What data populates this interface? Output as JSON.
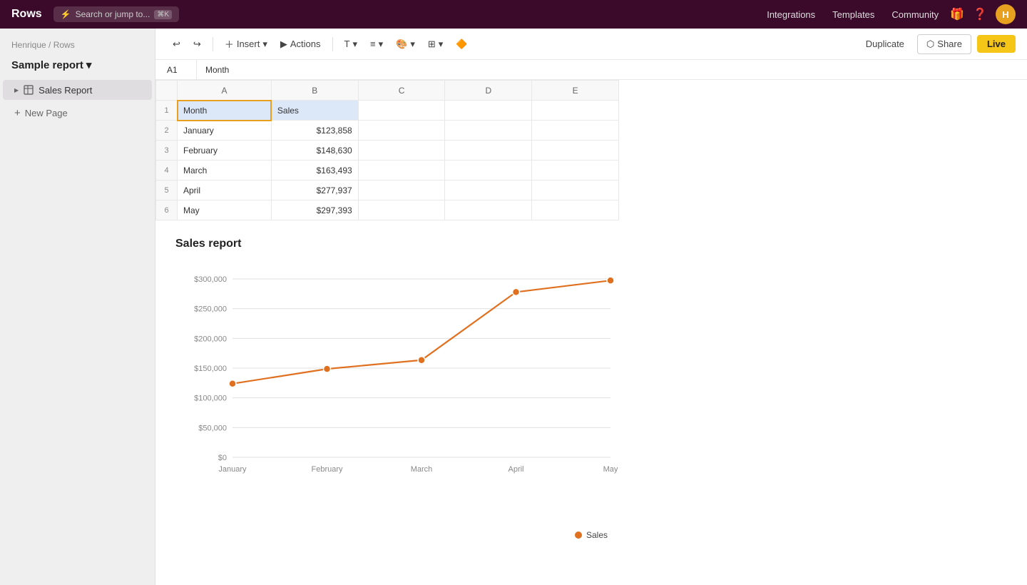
{
  "app": {
    "name": "Rows"
  },
  "topnav": {
    "logo": "Rows",
    "search_placeholder": "Search or jump to...",
    "search_shortcut": "⌘K",
    "links": [
      {
        "label": "Integrations",
        "id": "integrations"
      },
      {
        "label": "Templates",
        "id": "templates"
      },
      {
        "label": "Community",
        "id": "community"
      }
    ],
    "avatar_initial": "H"
  },
  "toolbar": {
    "insert_label": "Insert",
    "actions_label": "Actions",
    "duplicate_label": "Duplicate",
    "share_label": "Share",
    "live_label": "Live"
  },
  "cell_ref": {
    "ref": "A1",
    "value": "Month"
  },
  "sidebar": {
    "breadcrumb": "Henrique / Rows",
    "report_title": "Sample report",
    "report_caret": "▾",
    "pages": [
      {
        "label": "Sales Report",
        "active": true
      }
    ],
    "new_page_label": "New Page"
  },
  "spreadsheet": {
    "col_headers": [
      "A",
      "B",
      "C",
      "D",
      "E"
    ],
    "rows": [
      {
        "num": 1,
        "a": "Month",
        "b": "Sales",
        "c": "",
        "d": "",
        "e": ""
      },
      {
        "num": 2,
        "a": "January",
        "b": "$123,858",
        "c": "",
        "d": "",
        "e": ""
      },
      {
        "num": 3,
        "a": "February",
        "b": "$148,630",
        "c": "",
        "d": "",
        "e": ""
      },
      {
        "num": 4,
        "a": "March",
        "b": "$163,493",
        "c": "",
        "d": "",
        "e": ""
      },
      {
        "num": 5,
        "a": "April",
        "b": "$277,937",
        "c": "",
        "d": "",
        "e": ""
      },
      {
        "num": 6,
        "a": "May",
        "b": "$297,393",
        "c": "",
        "d": "",
        "e": ""
      }
    ]
  },
  "chart": {
    "title": "Sales report",
    "legend_label": "Sales",
    "color": "#e07020",
    "x_labels": [
      "January",
      "February",
      "March",
      "April",
      "May"
    ],
    "y_labels": [
      "$300,000",
      "$250,000",
      "$200,000",
      "$150,000",
      "$100,000",
      "$50,000",
      "$0"
    ],
    "data_points": [
      {
        "month": "January",
        "value": 123858
      },
      {
        "month": "February",
        "value": 148630
      },
      {
        "month": "March",
        "value": 163493
      },
      {
        "month": "April",
        "value": 277937
      },
      {
        "month": "May",
        "value": 297393
      }
    ],
    "y_min": 0,
    "y_max": 300000
  }
}
